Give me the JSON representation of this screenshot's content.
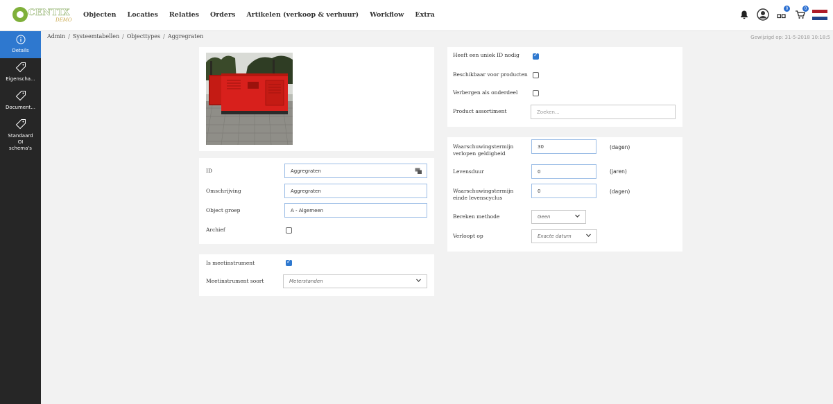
{
  "header": {
    "logo_text": "CENTIX",
    "logo_sub": "DEMO",
    "nav": [
      "Objecten",
      "Locaties",
      "Relaties",
      "Orders",
      "Artikelen (verkoop & verhuur)",
      "Workflow",
      "Extra"
    ],
    "badges": {
      "apps": "0",
      "cart": "0"
    },
    "flag_colors": [
      "#ae1c28",
      "#ffffff",
      "#21468b"
    ]
  },
  "sidebar": {
    "items": [
      {
        "label": "Details",
        "icon": "info-icon",
        "active": true
      },
      {
        "label": "Eigenscha...",
        "icon": "tag-icon",
        "active": false
      },
      {
        "label": "Document...",
        "icon": "tag-icon",
        "active": false
      },
      {
        "label": "Standaard\nOI\nschema's",
        "icon": "tag-icon",
        "active": false
      }
    ]
  },
  "breadcrumb": [
    "Admin",
    "Systeemtabellen",
    "Objecttypes",
    "Aggregraten"
  ],
  "modified": "Gewijzigd op: 31-5-2018 10:18:5",
  "general": {
    "id_label": "ID",
    "id_value": "Aggregraten",
    "omschrijving_label": "Omschrijving",
    "omschrijving_value": "Aggregraten",
    "objectgroep_label": "Object groep",
    "objectgroep_value": "A - Algemeen",
    "archief_label": "Archief",
    "archief_checked": false
  },
  "meet": {
    "is_label": "Is meetinstrument",
    "is_checked": true,
    "soort_label": "Meetinstrument soort",
    "soort_value": "Meterstanden"
  },
  "options": {
    "uniek_label": "Heeft een uniek ID nodig",
    "uniek_checked": true,
    "beschikbaar_label": "Beschikbaar voor producten",
    "beschikbaar_checked": false,
    "verbergen_label": "Verbergen als onderdeel",
    "verbergen_checked": false,
    "assortiment_label": "Product assortiment",
    "assortiment_placeholder": "Zoeken..."
  },
  "terms": {
    "waarsch_geldig_label": "Waarschuwingstermijn\nverlopen geldigheid",
    "waarsch_geldig_value": "30",
    "waarsch_geldig_unit": "(dagen)",
    "levensduur_label": "Levensduur",
    "levensduur_value": "0",
    "levensduur_unit": "(jaren)",
    "waarsch_einde_label": "Waarschuwingstermijn\neinde levenscyclus",
    "waarsch_einde_value": "0",
    "waarsch_einde_unit": "(dagen)",
    "bereken_label": "Bereken methode",
    "bereken_value": "Geen",
    "verloopt_label": "Verloopt op",
    "verloopt_value": "Exacte datum"
  },
  "colors": {
    "accent": "#2e78cf",
    "sidebar_bg": "#262626",
    "generator_red": "#d8201c",
    "logo_green": "#7fb03a"
  }
}
